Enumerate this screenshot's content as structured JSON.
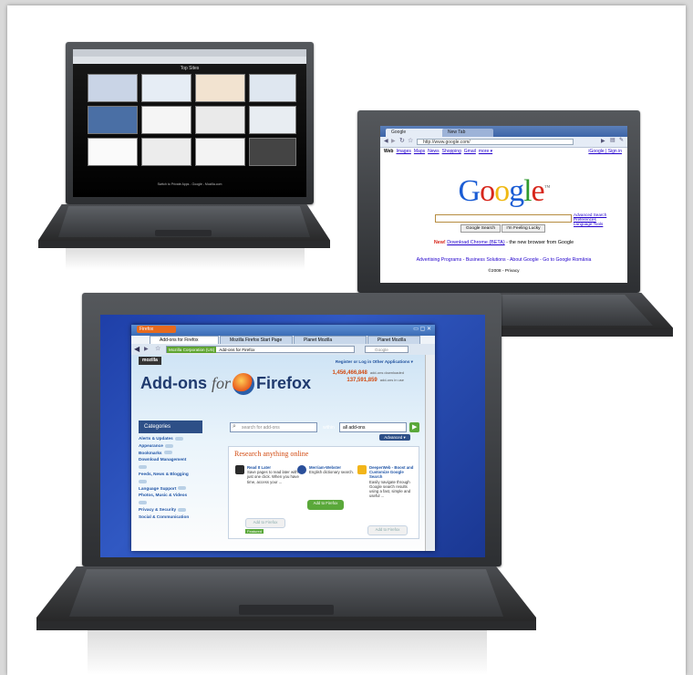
{
  "laptop1": {
    "tabs": [
      "Yahoo! Marketplace - Sale",
      "Top Sites",
      "Yahoo! Search",
      "Top Sites"
    ],
    "top_title": "Top Sites",
    "caption": "Switch to Private Apps - Google - Mozilla.com"
  },
  "google_window": {
    "tabs": [
      "Google",
      "New Tab"
    ],
    "url": "http://www.google.com/",
    "nav_links": [
      "Web",
      "Images",
      "Maps",
      "News",
      "Shopping",
      "Gmail",
      "more ▾"
    ],
    "account_links": "iGoogle | Sign in",
    "logo_letters": [
      {
        "ch": "G",
        "color": "#1a5cd4"
      },
      {
        "ch": "o",
        "color": "#d7271c"
      },
      {
        "ch": "o",
        "color": "#f0b812"
      },
      {
        "ch": "g",
        "color": "#1a5cd4"
      },
      {
        "ch": "l",
        "color": "#2f9a2f"
      },
      {
        "ch": "e",
        "color": "#d7271c"
      }
    ],
    "tm": "™",
    "search_links": [
      "Advanced Search",
      "Preferences",
      "Language Tools"
    ],
    "buttons": {
      "search": "Google Search",
      "lucky": "I'm Feeling Lucky"
    },
    "promo_new": "New!",
    "promo_link": "Download Chrome (BETA)",
    "promo_rest": " - the new browser from Google",
    "footer_links": "Advertising Programs - Business Solutions - About Google - Go to Google România",
    "copyright": "©2008 - Privacy"
  },
  "firefox_window": {
    "menu_label": "Firefox",
    "tabs": [
      "Add-ons for Firefox",
      "Mozilla Firefox Start Page",
      "Planet Mozilla",
      "Planet Mozilla"
    ],
    "identity": "Mozilla Corporation (US)",
    "url": "Add-ons for Firefox",
    "search_placeholder": "Google",
    "mozilla_tag": "mozilla",
    "top_links": "Register or Log in     Other Applications ▾",
    "heading_pre": "Add-ons",
    "heading_for": "for",
    "heading_post": "Firefox",
    "stats": [
      {
        "num": "1,456,466,848",
        "label": "add-ons downloaded"
      },
      {
        "num": "137,591,859",
        "label": "add-ons in use"
      }
    ],
    "categories_title": "Categories",
    "categories": [
      "Alerts & Updates",
      "Appearance",
      "Bookmarks",
      "Download Management",
      "Feeds, News & Blogging",
      "Language Support",
      "Photos, Music & Videos",
      "Privacy & Security",
      "Social & Communication"
    ],
    "addon_search_placeholder": "search for add-ons",
    "within_label": "within",
    "within_value": "all add-ons",
    "advanced_label": "Advanced ▾",
    "research_title": "Research anything online",
    "addons": [
      {
        "name": "Read It Later",
        "desc": "Save pages to read later with just one click. When you have time, access your ...",
        "icon_color": "#2b2b2b"
      },
      {
        "name": "Merriam-Webster",
        "desc": "English dictionary search.",
        "icon_color": "#2a4f9a"
      },
      {
        "name": "DeeperWeb - Boost and Customize Google Search",
        "desc": "Easily navigate through Google search results using a fast, simple and useful ...",
        "icon_color": "#f2b51a"
      }
    ],
    "add_label": "Add to Firefox",
    "featured_label": "Featured"
  }
}
